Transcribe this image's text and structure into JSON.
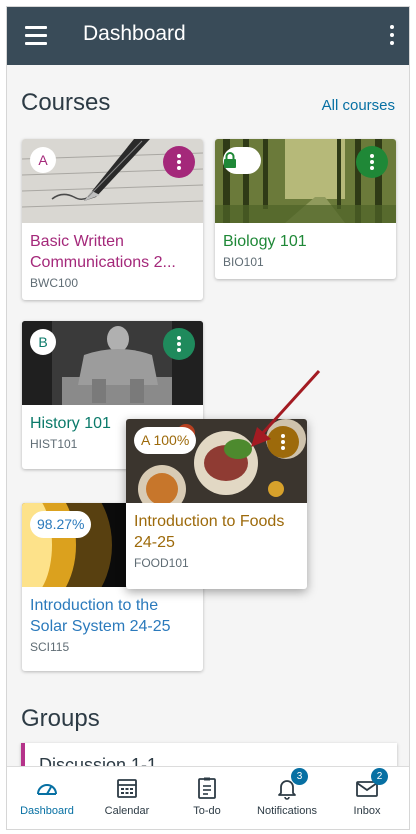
{
  "header": {
    "title": "Dashboard"
  },
  "courses_section": {
    "title": "Courses",
    "all_courses_label": "All courses"
  },
  "courses": [
    {
      "badge": "A",
      "name": "Basic Written Communications 2...",
      "code": "BWC100",
      "color": "#a4287a",
      "image": "fountain-pen-photo",
      "badge_icon": ""
    },
    {
      "badge": "",
      "name": "Biology 101",
      "code": "BIO101",
      "color": "#1f8837",
      "image": "forest-path-photo",
      "badge_icon": "lock-icon"
    },
    {
      "badge": "B",
      "name": "History 101",
      "code": "HIST101",
      "color": "#0b7a6a",
      "image": "lincoln-memorial-photo",
      "badge_icon": ""
    },
    {
      "badge": "A 100%",
      "name": "Introduction to Foods 24-25",
      "code": "FOOD101",
      "color": "#9d6a0b",
      "image": "food-platter-photo",
      "badge_icon": ""
    },
    {
      "badge": "98.27%",
      "name": "Introduction to the Solar System  24-25",
      "code": "SCI115",
      "color": "#2b7abc",
      "image": "sun-glow-photo",
      "badge_icon": ""
    }
  ],
  "groups_section": {
    "title": "Groups"
  },
  "groups": [
    {
      "name": "Discussion 1-1",
      "color": "#b5338a"
    }
  ],
  "bottom_nav": [
    {
      "label": "Dashboard",
      "icon": "dashboard-icon",
      "active": true
    },
    {
      "label": "Calendar",
      "icon": "calendar-icon",
      "active": false
    },
    {
      "label": "To-do",
      "icon": "todo-icon",
      "active": false
    },
    {
      "label": "Notifications",
      "icon": "bell-icon",
      "badge": "3",
      "active": false
    },
    {
      "label": "Inbox",
      "icon": "envelope-icon",
      "badge": "2",
      "active": false
    }
  ],
  "colors": {
    "header_bg": "#394b58",
    "accent": "#0770a3",
    "annotation_arrow": "#a31b22"
  }
}
